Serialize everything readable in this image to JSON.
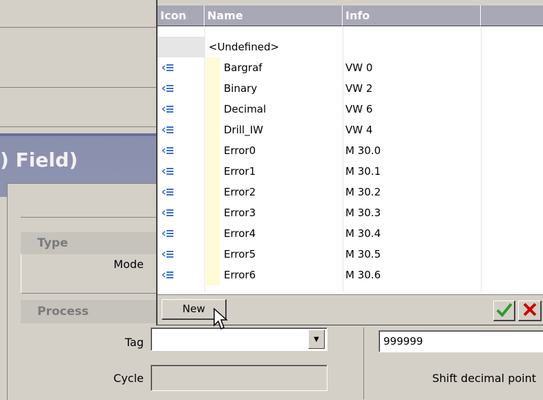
{
  "dialog": {
    "title": ") Field)",
    "sections": {
      "type": {
        "header": "Type",
        "mode_label": "Mode"
      },
      "process": {
        "header": "Process",
        "tag_label": "Tag",
        "cycle_label": "Cycle"
      }
    },
    "max_value": "999999",
    "shift_decimal_label": "Shift decimal point"
  },
  "tag_list": {
    "columns": [
      "Icon",
      "Name",
      "Info",
      ""
    ],
    "undefined_label": "<Undefined>",
    "rows": [
      {
        "name": "Bargraf",
        "info": "VW 0"
      },
      {
        "name": "Binary",
        "info": "VW 2"
      },
      {
        "name": "Decimal",
        "info": "VW 6"
      },
      {
        "name": "Drill_IW",
        "info": "VW 4"
      },
      {
        "name": "Error0",
        "info": "M 30.0"
      },
      {
        "name": "Error1",
        "info": "M 30.1"
      },
      {
        "name": "Error2",
        "info": "M 30.2"
      },
      {
        "name": "Error3",
        "info": "M 30.3"
      },
      {
        "name": "Error4",
        "info": "M 30.4"
      },
      {
        "name": "Error5",
        "info": "M 30.5"
      },
      {
        "name": "Error6",
        "info": "M 30.6"
      }
    ],
    "new_button": "New",
    "icons": {
      "row": "tag-icon",
      "ok": "checkmark-icon",
      "cancel": "close-icon",
      "cursor": "mouse-pointer-icon"
    },
    "colors": {
      "header_bg": "#a8a8b6",
      "name_marker": "#fffbd6",
      "ok": "#2e9a2e",
      "cancel": "#cc0000"
    }
  }
}
